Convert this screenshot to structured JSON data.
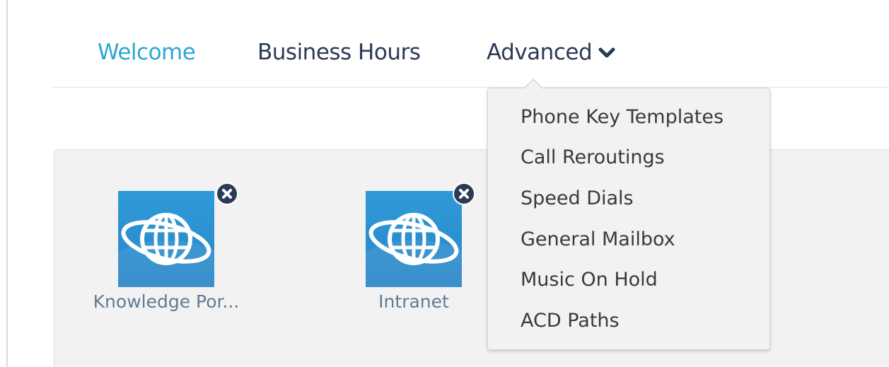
{
  "nav": {
    "welcome": "Welcome",
    "business_hours": "Business Hours",
    "advanced": "Advanced",
    "advanced_icon": "chevron-down-icon",
    "active_color": "#2ca7d2",
    "text_color": "#2b3a55"
  },
  "dropdown": {
    "items": [
      {
        "label": "Phone Key Templates"
      },
      {
        "label": "Call Reroutings"
      },
      {
        "label": "Speed Dials"
      },
      {
        "label": "General Mailbox"
      },
      {
        "label": "Music On Hold"
      },
      {
        "label": "ACD Paths"
      }
    ]
  },
  "tiles": [
    {
      "label": "Knowledge Por...",
      "icon": "globe-icon",
      "close_icon": "close-icon"
    },
    {
      "label": "Intranet",
      "icon": "globe-icon",
      "close_icon": "close-icon"
    }
  ],
  "colors": {
    "tile_blue": "#2f9ad8",
    "panel_bg": "#f2f2f2",
    "tile_label": "#5f7b96"
  }
}
